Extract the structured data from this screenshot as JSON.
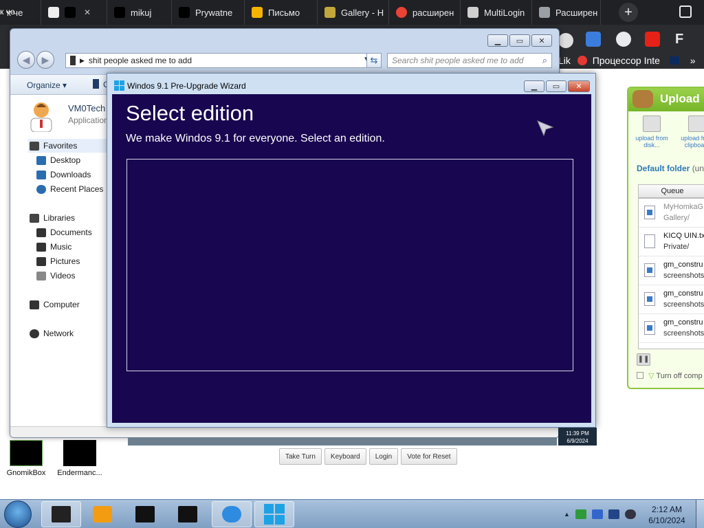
{
  "browser": {
    "tabs": [
      {
        "title": "к че",
        "color": "#202124"
      },
      {
        "title": "",
        "color": "#000000"
      },
      {
        "title": "mikuj",
        "color": "#000000"
      },
      {
        "title": "Prywatne",
        "color": "#1e88e5"
      },
      {
        "title": "Письмо",
        "color": "#f4b400"
      },
      {
        "title": "Gallery - H",
        "color": "#c2a83b"
      },
      {
        "title": "расширен",
        "color": "#ea4335"
      },
      {
        "title": "MultiLogin",
        "color": "#d0d0d0"
      },
      {
        "title": "Расширен",
        "color": "#9aa0a6"
      }
    ],
    "new_tab_label": "+",
    "bookmark_right": [
      "Lik",
      "Процессор Inte",
      "»"
    ]
  },
  "explorer": {
    "address_path": "shit people asked me to add",
    "search_placeholder": "Search shit people asked me to add",
    "toolbar": {
      "organize": "Organize",
      "second": "C"
    },
    "header": {
      "name": "VM0Tech",
      "subtitle": "Application"
    },
    "nav": [
      {
        "label": "Favorites",
        "icon": "star-icon",
        "color": "#444444"
      },
      {
        "label": "Desktop",
        "icon": "desktop-icon",
        "color": "#2b6cb0"
      },
      {
        "label": "Downloads",
        "icon": "downloads-icon",
        "color": "#2b6cb0"
      },
      {
        "label": "Recent Places",
        "icon": "recent-places-icon",
        "color": "#2b6cb0"
      },
      {
        "label": "Libraries",
        "icon": "libraries-icon",
        "color": "#444444"
      },
      {
        "label": "Documents",
        "icon": "documents-icon",
        "color": "#333333"
      },
      {
        "label": "Music",
        "icon": "music-icon",
        "color": "#333333"
      },
      {
        "label": "Pictures",
        "icon": "pictures-icon",
        "color": "#333333"
      },
      {
        "label": "Videos",
        "icon": "videos-icon",
        "color": "#666666"
      },
      {
        "label": "Computer",
        "icon": "computer-icon",
        "color": "#333333"
      },
      {
        "label": "Network",
        "icon": "network-icon",
        "color": "#333333"
      }
    ]
  },
  "wizard": {
    "title": "Windos 9.1 Pre-Upgrade Wizard",
    "heading": "Select edition",
    "subheading": "We make Windos 9.1 for everyone. Select an edition.",
    "background": "#180650"
  },
  "remote": {
    "vm_time": "11:39 PM",
    "vm_date": "6/9/2024",
    "buttons": [
      "Take Turn",
      "Keyboard",
      "Login",
      "Vote for Reset"
    ]
  },
  "desktop_icons": [
    {
      "label": "GnomikBox"
    },
    {
      "label": "Endermanc..."
    }
  ],
  "upload": {
    "title": "Upload",
    "btn_disk": "upload from disk...",
    "btn_clip": "upload from clipboard",
    "default_folder": "Default folder",
    "default_folder_suffix": "(un",
    "queue_header": "Queue",
    "queue": [
      {
        "name": "MyHomkaG",
        "path": "Gallery/",
        "dim": true,
        "type": "image"
      },
      {
        "name": "KICQ UIN.tx",
        "path": "Private/",
        "dim": false,
        "type": "text"
      },
      {
        "name": "gm_constru",
        "path": "screenshots/",
        "dim": false,
        "type": "image"
      },
      {
        "name": "gm_constru",
        "path": "screenshots/",
        "dim": false,
        "type": "image"
      },
      {
        "name": "gm_constru",
        "path": "screenshots/",
        "dim": false,
        "type": "image"
      }
    ],
    "turn_off": "Turn off comp"
  },
  "taskbar": {
    "time": "2:12 AM",
    "date": "6/10/2024"
  }
}
